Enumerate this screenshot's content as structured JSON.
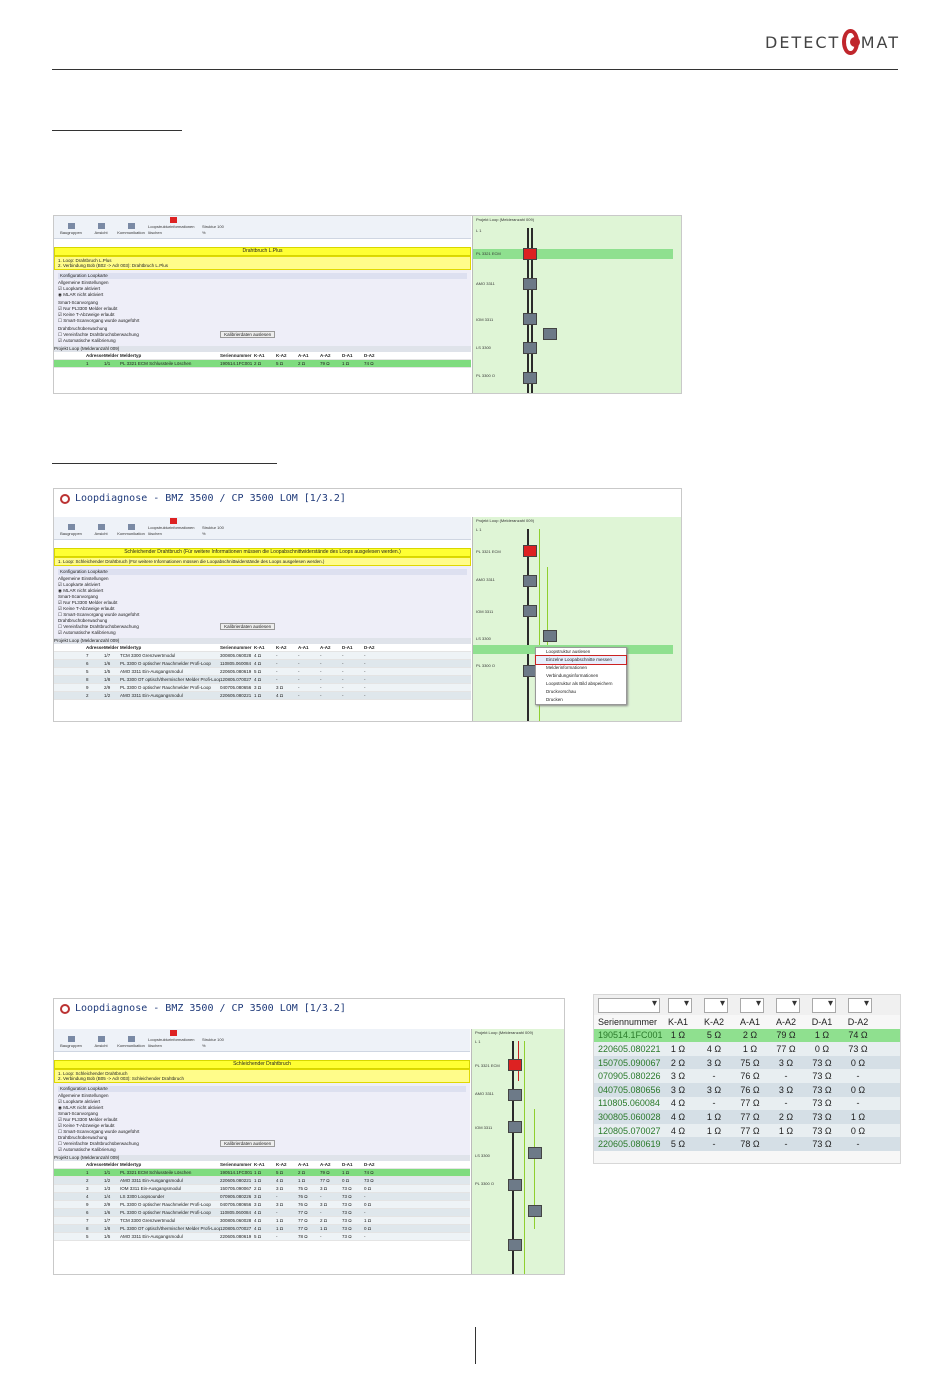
{
  "header": {
    "logo_text": "DETECT",
    "logo_text2": "MAT"
  },
  "shot1": {
    "toolbar": [
      "Baugruppen",
      "Ansicht",
      "Kommunikation",
      "Loopstrukturinformationen löschen"
    ],
    "strukturLabel": "Struktur",
    "strukturValue": "100 %",
    "banner": "Drahtbruch L.Plus",
    "messages": [
      "1. Loop: Drahtbruch L.Plus",
      "2. Verbindung Bob (B02 -> Adr 003): Drahtbruch L.Plus"
    ],
    "config": [
      "Konfiguration Loopkarte",
      "Allgemeine Einstellungen",
      "Loopkarte aktiviert",
      "MLAR nicht aktiviert",
      "Smart-Scanvorgang",
      "Nur PL3300 Melder erlaubt",
      "Keine T-Abzweige erlaubt",
      "Smart-Scanvorgang wurde ausgeführt",
      "Drahtbruchüberwachung",
      "Vereinfachte Drahtbruchüberwachung",
      "Automatische Kalibrierung",
      "Kalibrierdaten auslesen",
      "Loop kalibrieren"
    ],
    "gridTitle": "Projekt Loop (Melderanzahl 009)",
    "columns": [
      "Adresse",
      "Melder",
      "Meldertyp",
      "Seriennummer",
      "K-A1",
      "K-A2",
      "A-A1",
      "A-A2",
      "D-A1",
      "D-A2"
    ],
    "rows": [
      [
        "1",
        "1/1",
        "PL 3321 ECM Schlussteile Löschen",
        "190514.1FC001",
        "2 Ω",
        "5 Ω",
        "2 Ω",
        "79 Ω",
        "1 Ω",
        "74 Ω"
      ]
    ],
    "rightTitle": "Projekt Loop (Melderanzahl 009)",
    "nodes": [
      "L 1",
      "PL 3321 ECM",
      "AMO 3311",
      "IOM 3311",
      "LS 3300",
      "PL 3300 O"
    ]
  },
  "shot2": {
    "title": "Loopdiagnose - BMZ 3500 / CP 3500 LOM [1/3.2]",
    "banner": "Schleichender Drahtbruch (Für weitere Informationen müssen die Loopabschnittwiderstände des Loops ausgelesen werden.)",
    "messages": [
      "1. Loop: Schleichender Drahtbruch (Für weitere Informationen müssen die Loopabschnittwiderstände des Loops ausgelesen werden.)"
    ],
    "gridTitle": "Projekt Loop (Melderanzahl 009)",
    "rows": [
      [
        "7",
        "1/7",
        "TCM 3300 Grenzwertmodul",
        "300805.060028",
        "4 Ω",
        "-",
        "-",
        "-",
        "-",
        "-"
      ],
      [
        "6",
        "1/6",
        "PL 3300 O optischer Rauchmelder Profi-Loop",
        "110805.060084",
        "4 Ω",
        "-",
        "-",
        "-",
        "-",
        "-"
      ],
      [
        "5",
        "1/5",
        "AMO 3311 Ein-Ausgangsmodul",
        "220605.080619",
        "5 Ω",
        "-",
        "-",
        "-",
        "-",
        "-"
      ],
      [
        "8",
        "1/8",
        "PL 3300 OT optisch/thermischer Melder Profi-Loop",
        "120805.070027",
        "4 Ω",
        "-",
        "-",
        "-",
        "-",
        "-"
      ],
      [
        "9",
        "2/9",
        "PL 3300 O optischer Rauchmelder Profi-Loop",
        "040705.080656",
        "3 Ω",
        "3 Ω",
        "-",
        "-",
        "-",
        "-"
      ],
      [
        "2",
        "1/2",
        "AMO 3311 Ein-Ausgangsmodul",
        "220605.080221",
        "1 Ω",
        "4 Ω",
        "-",
        "-",
        "-",
        "-"
      ]
    ],
    "contextMenu": [
      "Loopstruktur auslesen",
      "Einzelne Loopabschnitte messen",
      "Melderinformationen",
      "Verbindungsinformationen",
      "Loopstruktur als Bild abspeichern",
      "Druckvorschau",
      "Drucken"
    ]
  },
  "shot3": {
    "title": "Loopdiagnose - BMZ 3500 / CP 3500 LOM [1/3.2]",
    "banner": "Schleichender Drahtbruch",
    "messages": [
      "1. Loop: Schleichender Drahtbruch",
      "2. Verbindung Bob (B05 -> Adr 003): Schleichender Drahtbruch"
    ],
    "gridTitle": "Projekt Loop (Melderanzahl 009)",
    "rows": [
      [
        "1",
        "1/1",
        "PL 3321 ECM Schlussteile Löschen",
        "190514.1FC001",
        "1 Ω",
        "5 Ω",
        "2 Ω",
        "79 Ω",
        "1 Ω",
        "74 Ω"
      ],
      [
        "2",
        "1/2",
        "AMO 3311 Ein-Ausgangsmodul",
        "220605.080221",
        "1 Ω",
        "4 Ω",
        "1 Ω",
        "77 Ω",
        "0 Ω",
        "73 Ω"
      ],
      [
        "3",
        "1/3",
        "IOM 3311 Ein-Ausgangsmodul",
        "150705.090067",
        "2 Ω",
        "3 Ω",
        "75 Ω",
        "3 Ω",
        "73 Ω",
        "0 Ω"
      ],
      [
        "4",
        "1/4",
        "LS 3300 Loopsounder",
        "070905.080226",
        "3 Ω",
        "-",
        "76 Ω",
        "-",
        "73 Ω",
        "-"
      ],
      [
        "9",
        "2/9",
        "PL 3300 O optischer Rauchmelder Profi-Loop",
        "040705.080656",
        "3 Ω",
        "3 Ω",
        "76 Ω",
        "3 Ω",
        "73 Ω",
        "0 Ω"
      ],
      [
        "6",
        "1/6",
        "PL 3300 O optischer Rauchmelder Profi-Loop",
        "110805.060084",
        "4 Ω",
        "-",
        "77 Ω",
        "-",
        "73 Ω",
        "-"
      ],
      [
        "7",
        "1/7",
        "TCM 3300 Grenzwertmodul",
        "300805.060028",
        "4 Ω",
        "1 Ω",
        "77 Ω",
        "2 Ω",
        "73 Ω",
        "1 Ω"
      ],
      [
        "8",
        "1/8",
        "PL 3300 OT optisch/thermischer Melder Profi-Loop",
        "120805.070027",
        "4 Ω",
        "1 Ω",
        "77 Ω",
        "1 Ω",
        "73 Ω",
        "0 Ω"
      ],
      [
        "5",
        "1/5",
        "AMO 3311 Ein-Ausgangsmodul",
        "220605.080619",
        "5 Ω",
        "-",
        "78 Ω",
        "-",
        "73 Ω",
        "-"
      ]
    ]
  },
  "zoom": {
    "columns": [
      "Seriennummer",
      "K-A1",
      "K-A2",
      "A-A1",
      "A-A2",
      "D-A1",
      "D-A2"
    ],
    "rows": [
      [
        "190514.1FC001",
        "1 Ω",
        "5 Ω",
        "2 Ω",
        "79 Ω",
        "1 Ω",
        "74 Ω"
      ],
      [
        "220605.080221",
        "1 Ω",
        "4 Ω",
        "1 Ω",
        "77 Ω",
        "0 Ω",
        "73 Ω"
      ],
      [
        "150705.090067",
        "2 Ω",
        "3 Ω",
        "75 Ω",
        "3 Ω",
        "73 Ω",
        "0 Ω"
      ],
      [
        "070905.080226",
        "3 Ω",
        "-",
        "76 Ω",
        "-",
        "73 Ω",
        "-"
      ],
      [
        "040705.080656",
        "3 Ω",
        "3 Ω",
        "76 Ω",
        "3 Ω",
        "73 Ω",
        "0 Ω"
      ],
      [
        "110805.060084",
        "4 Ω",
        "-",
        "77 Ω",
        "-",
        "73 Ω",
        "-"
      ],
      [
        "300805.060028",
        "4 Ω",
        "1 Ω",
        "77 Ω",
        "2 Ω",
        "73 Ω",
        "1 Ω"
      ],
      [
        "120805.070027",
        "4 Ω",
        "1 Ω",
        "77 Ω",
        "1 Ω",
        "73 Ω",
        "0 Ω"
      ],
      [
        "220605.080619",
        "5 Ω",
        "-",
        "78 Ω",
        "-",
        "73 Ω",
        "-"
      ]
    ]
  }
}
